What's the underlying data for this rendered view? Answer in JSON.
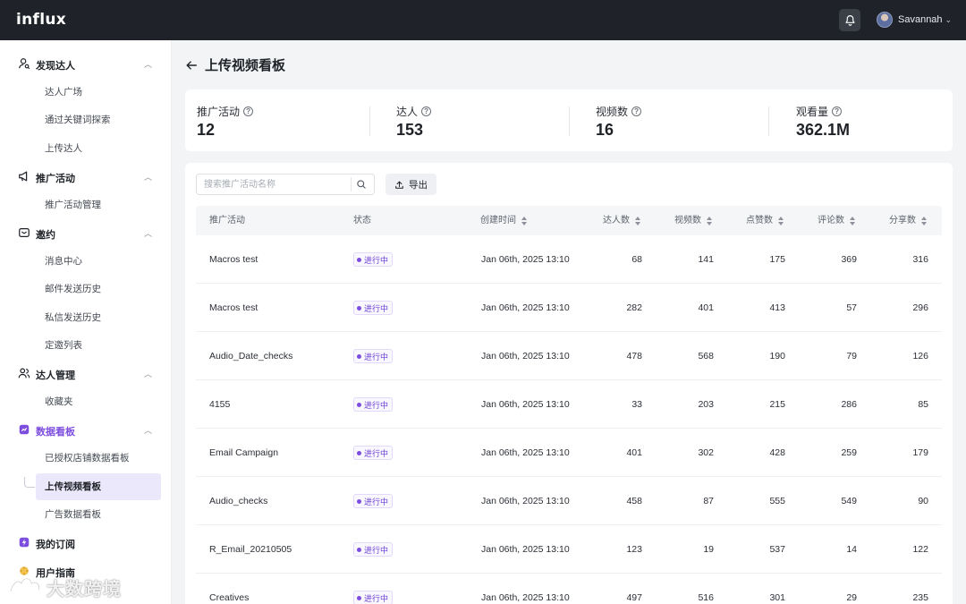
{
  "app": {
    "logo": "influx"
  },
  "topbar": {
    "user_name": "Savannah",
    "caret": "⌄"
  },
  "sidebar": {
    "groups": [
      {
        "label": "发现达人",
        "icon": "user-search-icon",
        "items": [
          "达人广场",
          "通过关键词探索",
          "上传达人"
        ]
      },
      {
        "label": "推广活动",
        "icon": "megaphone-icon",
        "items": [
          "推广活动管理"
        ]
      },
      {
        "label": "邀约",
        "icon": "mail-icon",
        "items": [
          "消息中心",
          "邮件发送历史",
          "私信发送历史",
          "定邀列表"
        ]
      },
      {
        "label": "达人管理",
        "icon": "users-icon",
        "items": [
          "收藏夹"
        ]
      },
      {
        "label": "数据看板",
        "icon": "dashboard-icon",
        "items": [
          "已授权店铺数据看板",
          "上传视频看板",
          "广告数据看板"
        ]
      },
      {
        "label": "我的订阅",
        "icon": "lightning-icon",
        "items": []
      },
      {
        "label": "用户指南",
        "icon": "guide-icon",
        "items": []
      }
    ],
    "active_item": "上传视频看板",
    "watermark": "大数跨境"
  },
  "page": {
    "title": "上传视频看板"
  },
  "stats": [
    {
      "label": "推广活动",
      "value": "12"
    },
    {
      "label": "达人",
      "value": "153"
    },
    {
      "label": "视频数",
      "value": "16"
    },
    {
      "label": "观看量",
      "value": "362.1M"
    }
  ],
  "toolbar": {
    "search_placeholder": "搜索推广活动名称",
    "export_label": "导出"
  },
  "table": {
    "columns": [
      "推广活动",
      "状态",
      "创建时间",
      "达人数",
      "视频数",
      "点赞数",
      "评论数",
      "分享数"
    ],
    "status_label": "进行中",
    "rows": [
      {
        "name": "Macros test",
        "status": "进行中",
        "created": "Jan 06th, 2025 13:10",
        "creators": "68",
        "videos": "141",
        "likes": "175",
        "comments": "369",
        "shares": "316"
      },
      {
        "name": "Macros test",
        "status": "进行中",
        "created": "Jan 06th, 2025 13:10",
        "creators": "282",
        "videos": "401",
        "likes": "413",
        "comments": "57",
        "shares": "296"
      },
      {
        "name": "Audio_Date_checks",
        "status": "进行中",
        "created": "Jan 06th, 2025 13:10",
        "creators": "478",
        "videos": "568",
        "likes": "190",
        "comments": "79",
        "shares": "126"
      },
      {
        "name": "4155",
        "status": "进行中",
        "created": "Jan 06th, 2025 13:10",
        "creators": "33",
        "videos": "203",
        "likes": "215",
        "comments": "286",
        "shares": "85"
      },
      {
        "name": "Email Campaign",
        "status": "进行中",
        "created": "Jan 06th, 2025 13:10",
        "creators": "401",
        "videos": "302",
        "likes": "428",
        "comments": "259",
        "shares": "179"
      },
      {
        "name": "Audio_checks",
        "status": "进行中",
        "created": "Jan 06th, 2025 13:10",
        "creators": "458",
        "videos": "87",
        "likes": "555",
        "comments": "549",
        "shares": "90"
      },
      {
        "name": "R_Email_20210505",
        "status": "进行中",
        "created": "Jan 06th, 2025 13:10",
        "creators": "123",
        "videos": "19",
        "likes": "537",
        "comments": "14",
        "shares": "122"
      },
      {
        "name": "Creatives",
        "status": "进行中",
        "created": "Jan 06th, 2025 13:10",
        "creators": "497",
        "videos": "516",
        "likes": "301",
        "comments": "29",
        "shares": "235"
      }
    ]
  },
  "colors": {
    "topbar": "#1f2329",
    "accent": "#7c4ddf",
    "active_bg": "#ece8fb",
    "background": "#f3f4f6"
  }
}
